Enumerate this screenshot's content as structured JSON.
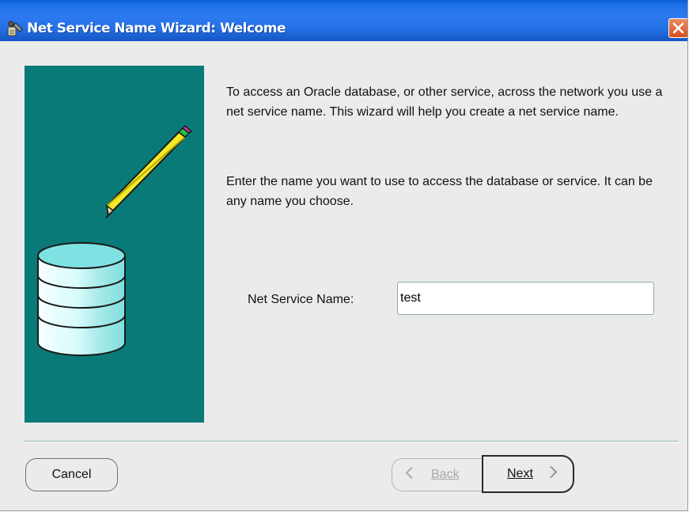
{
  "window": {
    "title": "Net Service Name Wizard: Welcome",
    "title_icon": "wizard-tools-icon",
    "close_icon": "close-icon",
    "titlebar_color": "#2470e6",
    "close_color": "#d8501c"
  },
  "illustration": {
    "background": "#0a7a78",
    "icons": [
      "pencil-icon",
      "database-icon"
    ]
  },
  "content": {
    "intro_text": "To access an Oracle database, or other service, across the network you use a net service name.  This wizard will help you create a net service name.",
    "instruction_text": "Enter the name you want to use to access the database or service.  It can be any name you choose.",
    "field_label": "Net Service Name:",
    "field_value": "test"
  },
  "buttons": {
    "cancel_label": "Cancel",
    "back_label": "Back",
    "next_label": "Next",
    "back_enabled": false
  }
}
